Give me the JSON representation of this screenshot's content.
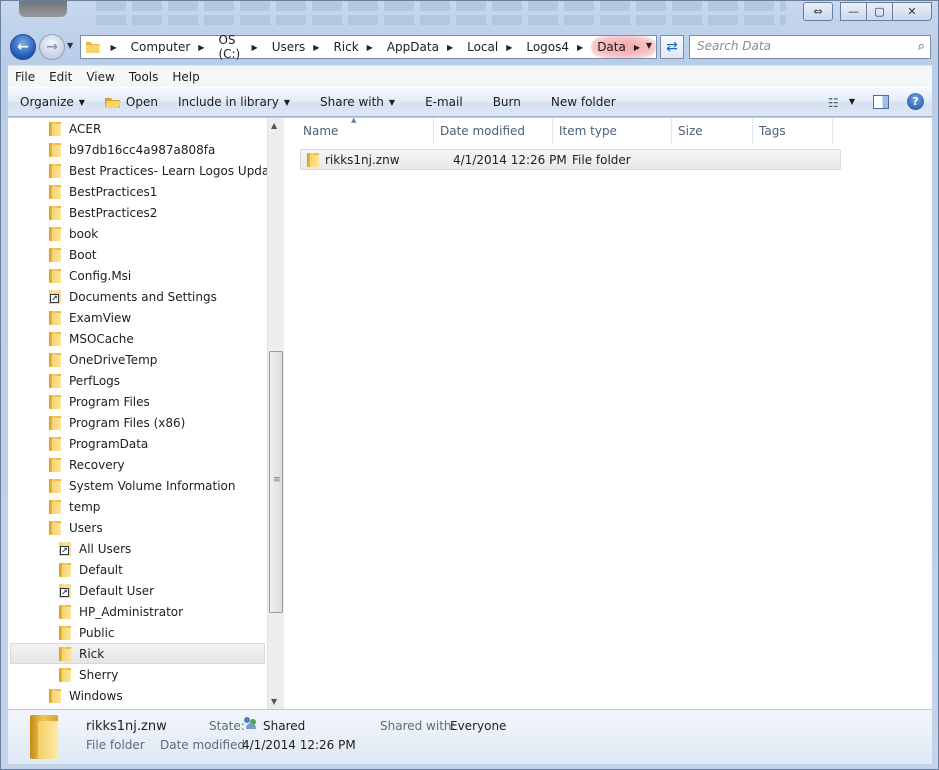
{
  "window": {
    "caption_buttons": {
      "swap": "⇔",
      "minimize": "—",
      "maximize": "▢",
      "close": "✕"
    }
  },
  "address": {
    "crumbs": [
      "Computer",
      "OS (C:)",
      "Users",
      "Rick",
      "AppData",
      "Local",
      "Logos4",
      "Data"
    ],
    "highlight_color": "#f3a6aa"
  },
  "search": {
    "placeholder": "Search Data"
  },
  "menu": [
    "File",
    "Edit",
    "View",
    "Tools",
    "Help"
  ],
  "commands": {
    "organize": "Organize",
    "open": "Open",
    "include_in_library": "Include in library",
    "share_with": "Share with",
    "email": "E-mail",
    "burn": "Burn",
    "new_folder": "New folder"
  },
  "nav_tree": {
    "items": [
      {
        "label": "ACER",
        "level": 0,
        "icon": "folder-icon"
      },
      {
        "label": "b97db16cc4a987a808fa",
        "level": 0,
        "icon": "folder-icon"
      },
      {
        "label": "Best Practices- Learn Logos Updates",
        "level": 0,
        "icon": "folder-icon"
      },
      {
        "label": "BestPractices1",
        "level": 0,
        "icon": "folder-icon"
      },
      {
        "label": "BestPractices2",
        "level": 0,
        "icon": "folder-icon"
      },
      {
        "label": "book",
        "level": 0,
        "icon": "folder-icon"
      },
      {
        "label": "Boot",
        "level": 0,
        "icon": "folder-icon"
      },
      {
        "label": "Config.Msi",
        "level": 0,
        "icon": "folder-icon"
      },
      {
        "label": "Documents and Settings",
        "level": 0,
        "icon": "folder-shortcut-icon"
      },
      {
        "label": "ExamView",
        "level": 0,
        "icon": "folder-icon"
      },
      {
        "label": "MSOCache",
        "level": 0,
        "icon": "folder-icon"
      },
      {
        "label": "OneDriveTemp",
        "level": 0,
        "icon": "folder-icon"
      },
      {
        "label": "PerfLogs",
        "level": 0,
        "icon": "folder-icon"
      },
      {
        "label": "Program Files",
        "level": 0,
        "icon": "folder-icon"
      },
      {
        "label": "Program Files (x86)",
        "level": 0,
        "icon": "folder-icon"
      },
      {
        "label": "ProgramData",
        "level": 0,
        "icon": "folder-icon"
      },
      {
        "label": "Recovery",
        "level": 0,
        "icon": "folder-icon"
      },
      {
        "label": "System Volume Information",
        "level": 0,
        "icon": "folder-icon"
      },
      {
        "label": "temp",
        "level": 0,
        "icon": "folder-icon"
      },
      {
        "label": "Users",
        "level": 0,
        "icon": "folder-icon"
      },
      {
        "label": "All Users",
        "level": 1,
        "icon": "folder-shortcut-icon"
      },
      {
        "label": "Default",
        "level": 1,
        "icon": "folder-icon"
      },
      {
        "label": "Default User",
        "level": 1,
        "icon": "folder-shortcut-icon"
      },
      {
        "label": "HP_Administrator",
        "level": 1,
        "icon": "folder-icon"
      },
      {
        "label": "Public",
        "level": 1,
        "icon": "folder-icon"
      },
      {
        "label": "Rick",
        "level": 1,
        "icon": "folder-icon",
        "selected": true
      },
      {
        "label": "Sherry",
        "level": 1,
        "icon": "folder-icon"
      },
      {
        "label": "Windows",
        "level": 0,
        "icon": "folder-icon"
      }
    ]
  },
  "columns": [
    "Name",
    "Date modified",
    "Item type",
    "Size",
    "Tags"
  ],
  "files": [
    {
      "name": "rikks1nj.znw",
      "date_modified": "4/1/2014 12:26 PM",
      "item_type": "File folder",
      "size": "",
      "tags": ""
    }
  ],
  "details": {
    "name": "rikks1nj.znw",
    "type": "File folder",
    "state_label": "State:",
    "state_value": "Shared",
    "shared_with_label": "Shared with:",
    "shared_with_value": "Everyone",
    "date_modified_label": "Date modified:",
    "date_modified_value": "4/1/2014 12:26 PM"
  }
}
